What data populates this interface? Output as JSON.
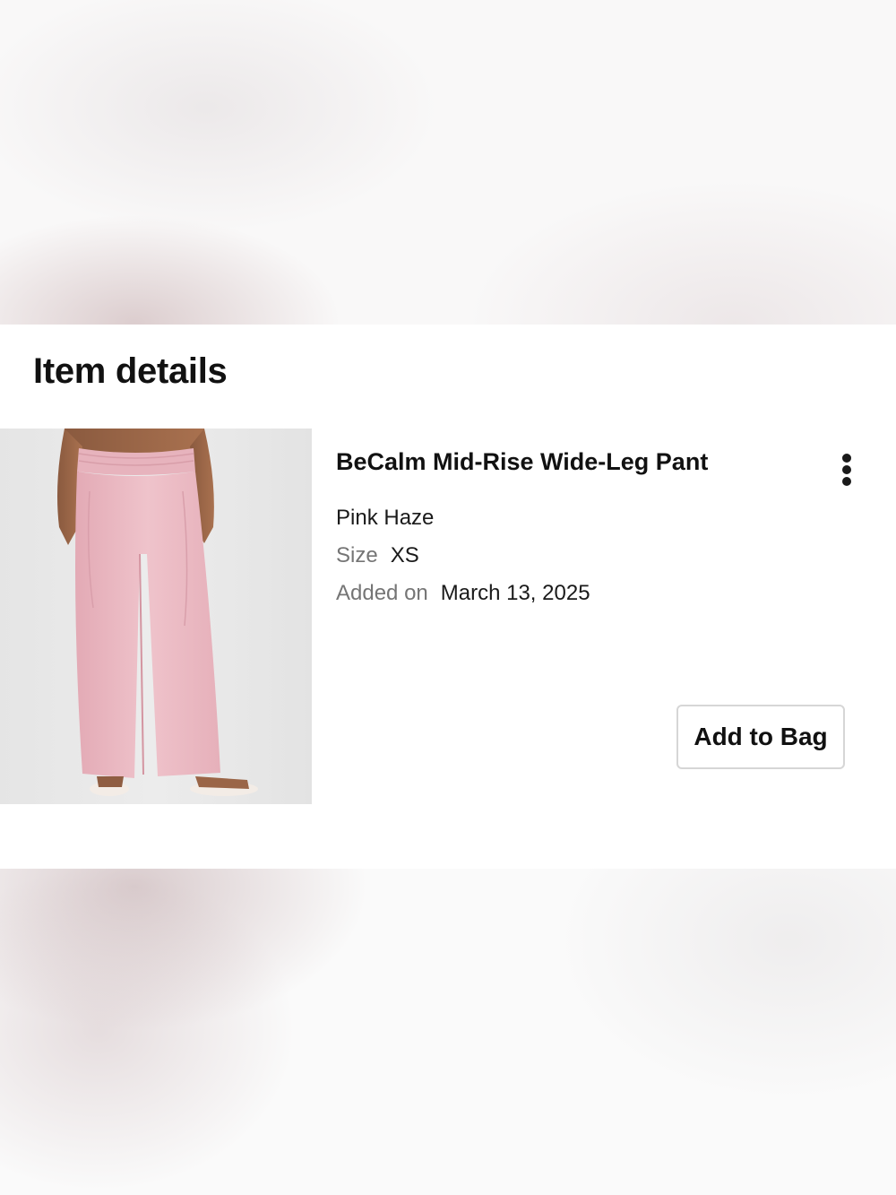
{
  "section": {
    "heading": "Item details"
  },
  "item": {
    "name": "BeCalm Mid-Rise Wide-Leg Pant",
    "color": "Pink Haze",
    "size_label": "Size",
    "size_value": "XS",
    "added_label": "Added on",
    "added_value": "March 13, 2025",
    "image_icon": "product-photo-pink-wide-leg-pants",
    "more_icon": "vertical-ellipsis-icon"
  },
  "actions": {
    "add_to_bag": "Add to Bag"
  },
  "colors": {
    "product_pink": "#e9b9c2",
    "text": "#111111",
    "muted_text": "#757575",
    "button_border": "#d6d6d6"
  }
}
